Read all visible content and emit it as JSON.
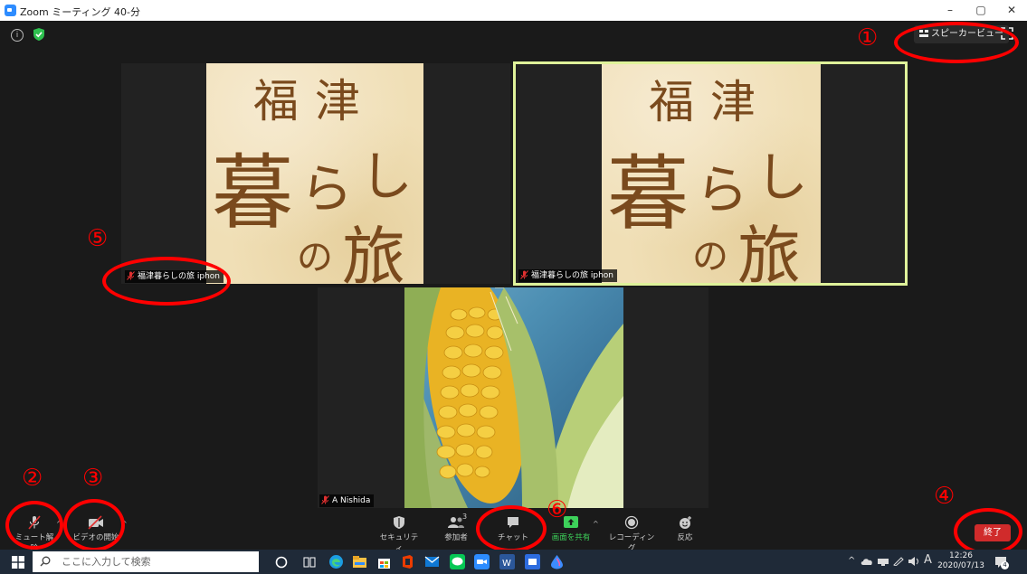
{
  "window": {
    "title": "Zoom ミーティング 40-分"
  },
  "top_bar": {
    "view_button_label": "スピーカービュー"
  },
  "tiles": [
    {
      "logo_text": [
        "福",
        "津",
        "暮",
        "ら",
        "し",
        "の",
        "旅"
      ],
      "participant_name": "福津暮らしの旅 iphon"
    },
    {
      "logo_text": [
        "福",
        "津",
        "暮",
        "ら",
        "し",
        "の",
        "旅"
      ],
      "participant_name": "福津暮らしの旅 iphon"
    },
    {
      "participant_name": "A Nishida"
    }
  ],
  "toolbar": {
    "unmute_label": "ミュート解除",
    "start_video_label": "ビデオの開始",
    "security_label": "セキュリティ",
    "participants_label": "参加者",
    "participants_count": "3",
    "chat_label": "チャット",
    "share_label": "画面を共有",
    "record_label": "レコーディング",
    "reactions_label": "反応",
    "end_label": "終了"
  },
  "annotations": [
    "①",
    "②",
    "③",
    "④",
    "⑤",
    "⑥"
  ],
  "taskbar": {
    "search_placeholder": "ここに入力して検索",
    "clock_time": "12:26",
    "clock_date": "2020/07/13",
    "notification_count": "4",
    "ime_indicator": "A"
  },
  "colors": {
    "accent_share": "#3dd15a",
    "end_button": "#d02b2b",
    "active_speaker_border": "#dff29a",
    "annotation_red": "#ff0000"
  }
}
